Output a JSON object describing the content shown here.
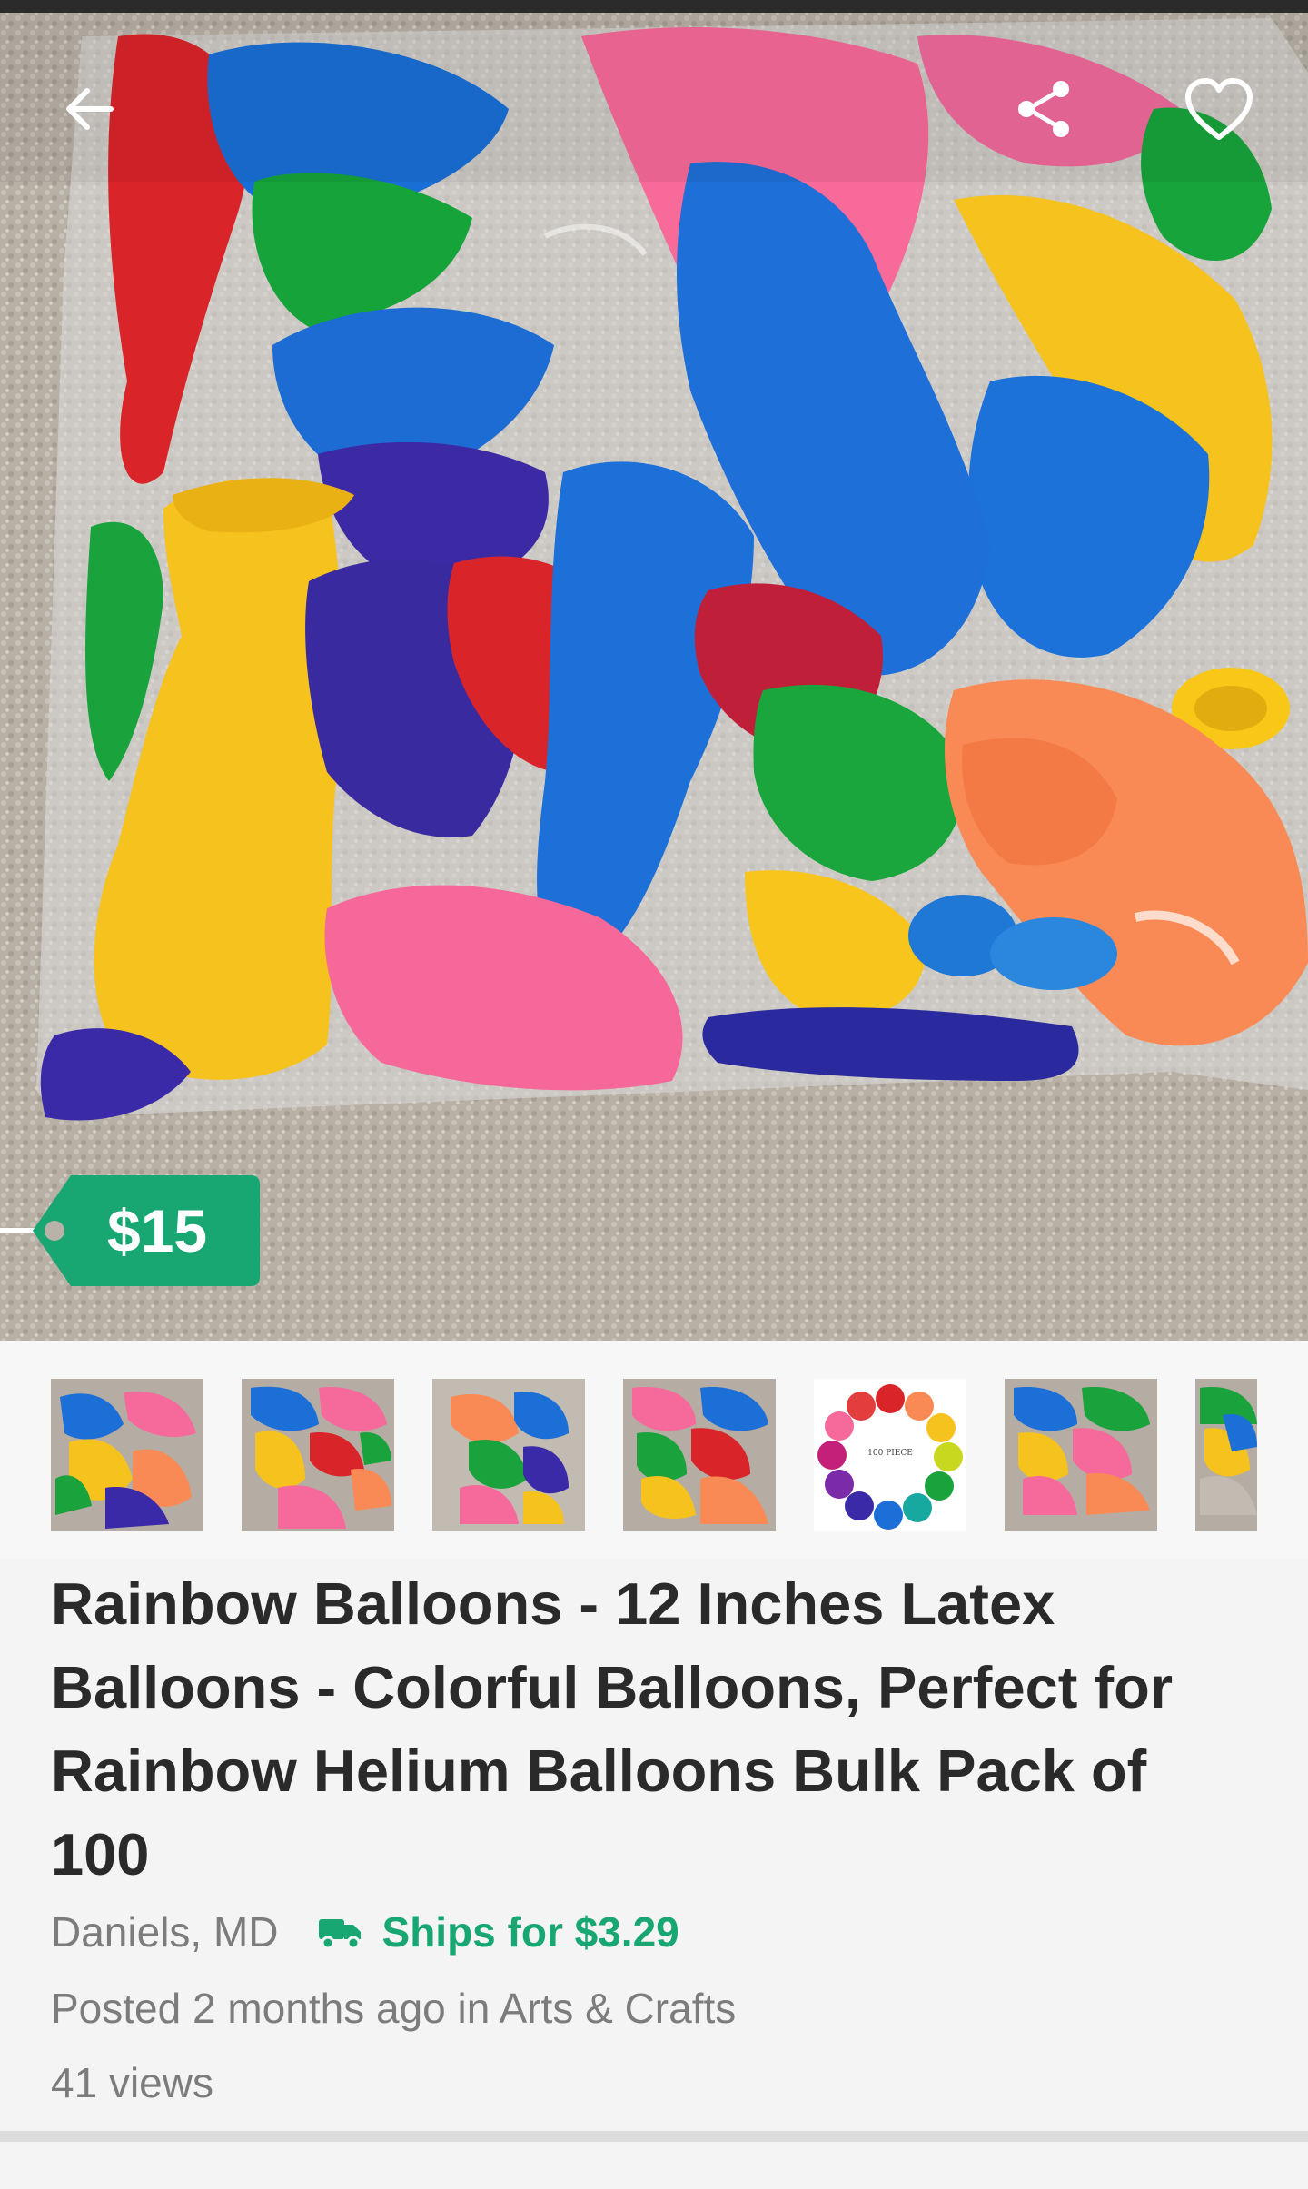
{
  "listing": {
    "price": "$15",
    "title": "Rainbow Balloons - 12 Inches Latex Balloons - Colorful Balloons, Perfect for Rainbow Helium Balloons Bulk Pack of 100",
    "location": "Daniels, MD",
    "shipping": "Ships for $3.29",
    "posted": "Posted 2 months ago in Arts & Crafts",
    "views": "41 views"
  },
  "thumbnail_badge": "100 PIECE",
  "icons": {
    "back": "back-arrow-icon",
    "share": "share-icon",
    "favorite": "heart-icon",
    "shipping": "truck-icon"
  },
  "colors": {
    "accent_green": "#18a673",
    "title_text": "#2a2a2a",
    "meta_text": "#7c7c7c",
    "background": "#f4f4f4"
  }
}
